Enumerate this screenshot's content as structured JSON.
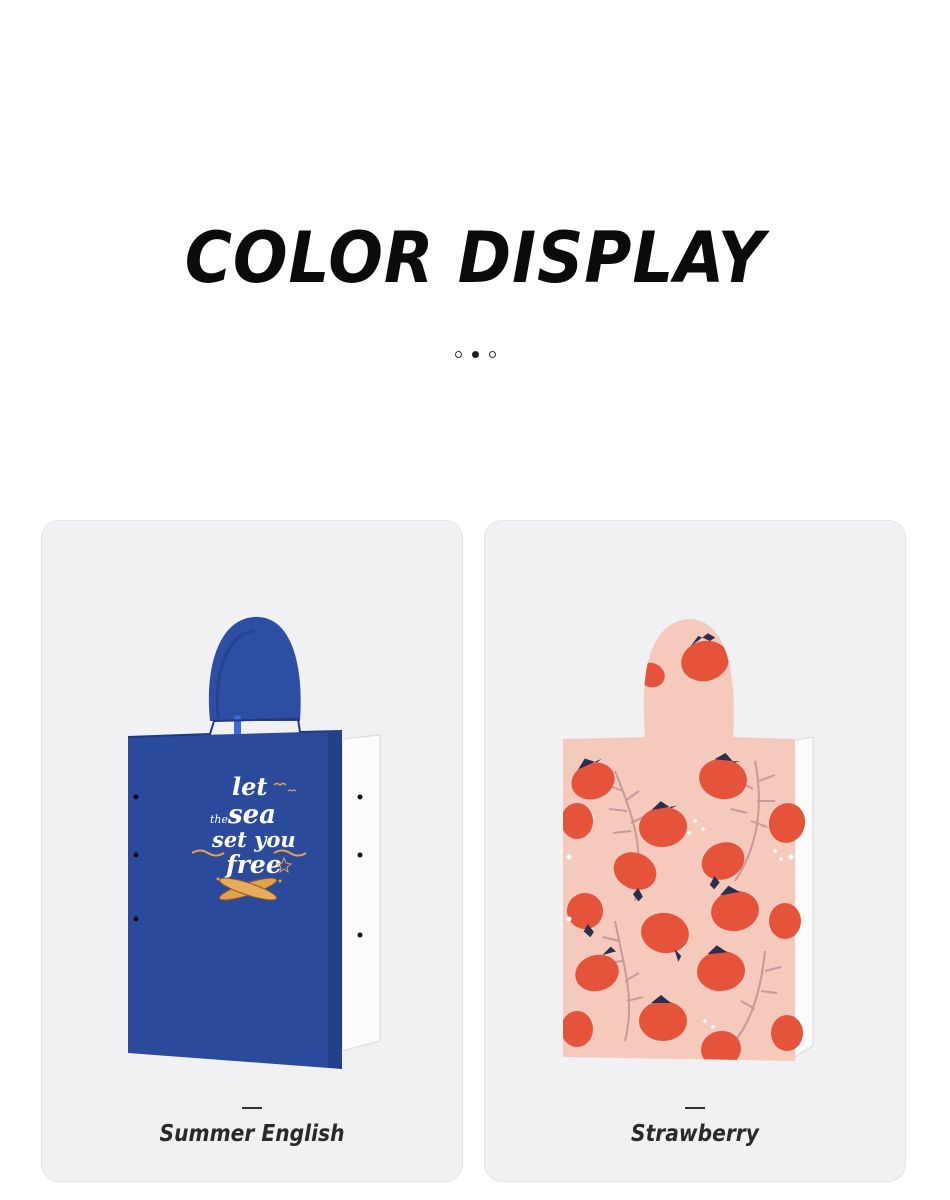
{
  "header": {
    "title": "COLOR DISPLAY"
  },
  "carousel": {
    "dot_count": 3,
    "active_index": 1
  },
  "products": [
    {
      "name": "Summer English",
      "print_text": [
        "let",
        "the",
        "sea",
        "set you",
        "free"
      ],
      "base_color": "#2c4a9b",
      "accent_color": "#e6a04a"
    },
    {
      "name": "Strawberry",
      "base_color": "#f6c9bd",
      "accent_color": "#e5533a"
    }
  ]
}
